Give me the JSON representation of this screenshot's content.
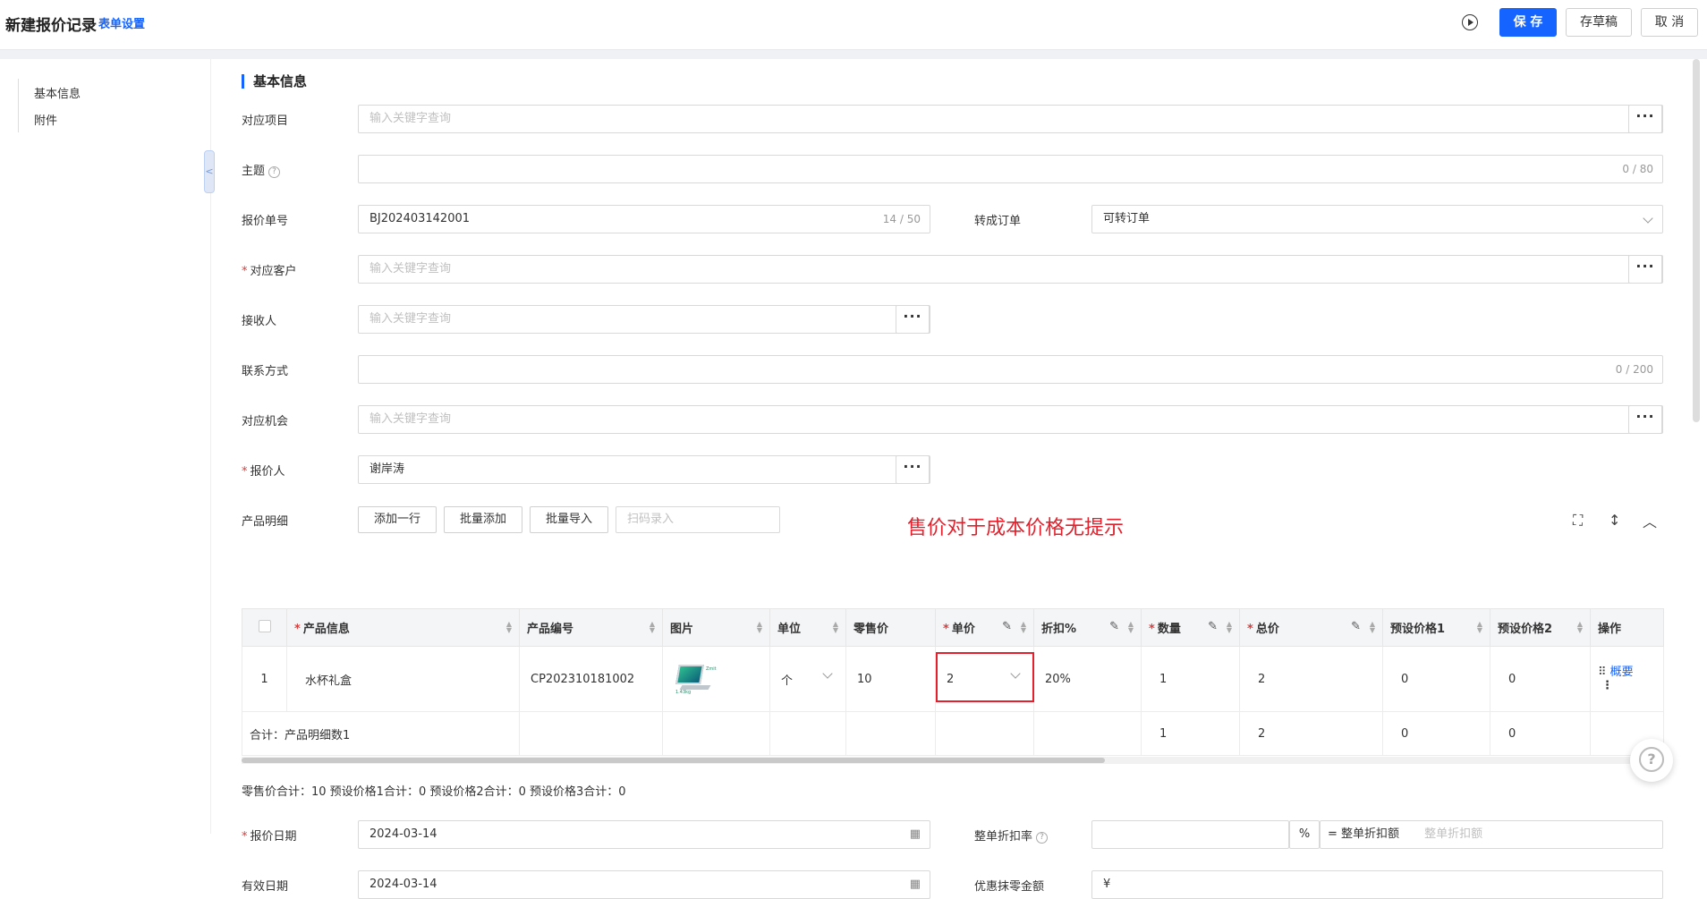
{
  "header": {
    "title": "新建报价记录",
    "settings_link": "表单设置",
    "save": "保 存",
    "draft": "存草稿",
    "cancel": "取 消"
  },
  "sidebar": {
    "items": [
      {
        "label": "基本信息"
      },
      {
        "label": "附件"
      }
    ]
  },
  "form": {
    "section_title": "基本信息",
    "fields": {
      "project": {
        "label": "对应项目",
        "placeholder": "输入关键字查询"
      },
      "subject": {
        "label": "主题",
        "count": "0 / 80"
      },
      "quote_no": {
        "label": "报价单号",
        "value": "BJ202403142001",
        "count": "14 / 50"
      },
      "to_order": {
        "label": "转成订单",
        "value": "可转订单"
      },
      "customer": {
        "label": "对应客户",
        "placeholder": "输入关键字查询"
      },
      "receiver": {
        "label": "接收人",
        "placeholder": "输入关键字查询"
      },
      "contact": {
        "label": "联系方式",
        "count": "0 / 200"
      },
      "opportunity": {
        "label": "对应机会",
        "placeholder": "输入关键字查询"
      },
      "quoter": {
        "label": "报价人",
        "value": "谢岸涛"
      },
      "products": {
        "label": "产品明细"
      },
      "quote_date": {
        "label": "报价日期",
        "value": "2024-03-14"
      },
      "valid_date": {
        "label": "有效日期",
        "value": "2024-03-14"
      },
      "discount_rate": {
        "label": "整单折扣率",
        "unit": "%",
        "eq_label": "= 整单折扣额",
        "placeholder": "整单折扣额"
      },
      "round_off": {
        "label": "优惠抹零金额",
        "currency": "¥"
      }
    },
    "required_mark": "*"
  },
  "products_toolbar": {
    "add_row": "添加一行",
    "batch_add": "批量添加",
    "batch_import": "批量导入",
    "scan_placeholder": "扫码录入"
  },
  "annotation": "售价对于成本价格无提示",
  "table": {
    "headers": [
      "产品信息",
      "产品编号",
      "图片",
      "单位",
      "零售价",
      "单价",
      "折扣%",
      "数量",
      "总价",
      "预设价格1",
      "预设价格2",
      "操作"
    ],
    "row": {
      "index": "1",
      "product": "水杯礼盒",
      "code": "CP202310181002",
      "unit": "个",
      "retail": "10",
      "price": "2",
      "discount": "20%",
      "qty": "1",
      "total": "2",
      "preset1": "0",
      "preset2": "0",
      "action": "概要",
      "image_text": "Zmit",
      "image_caption": "1.43kg"
    },
    "summary": {
      "label": "合计：产品明细数1",
      "qty": "1",
      "total": "2",
      "preset1": "0",
      "preset2": "0"
    }
  },
  "totals_line": "零售价合计：10  预设价格1合计：0  预设价格2合计：0  预设价格3合计：0",
  "colors": {
    "primary": "#1664ff",
    "required": "#e03b3b",
    "annotation": "#e3202b"
  },
  "icons": [
    "play-circle-icon",
    "more-dots-icon",
    "chevron-down-icon",
    "help-icon",
    "fullscreen-icon",
    "vertical-resize-icon",
    "chevron-up-icon",
    "edit-pen-icon",
    "sort-icon",
    "drag-handle-icon",
    "calendar-icon",
    "question-float-icon"
  ]
}
